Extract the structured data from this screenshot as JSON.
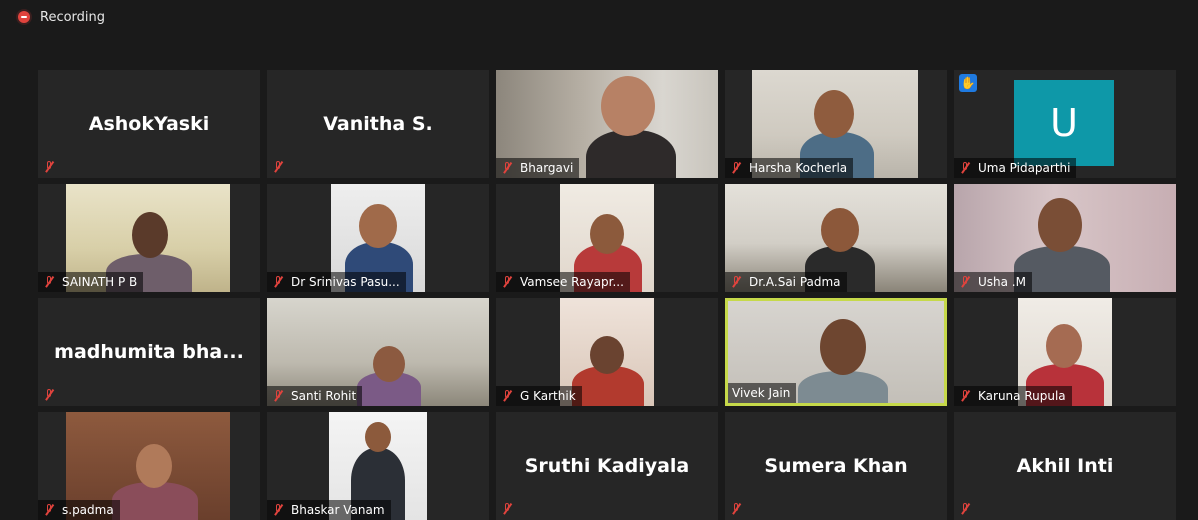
{
  "recording": {
    "label": "Recording",
    "icon": "record-icon"
  },
  "tiles": [
    {
      "name": "AshokYaski",
      "mode": "name"
    },
    {
      "name": "Vanitha S.",
      "mode": "name"
    },
    {
      "name": "Bhargavi",
      "mode": "video",
      "bg": "#b9b1a6"
    },
    {
      "name": "Harsha Kocherla",
      "mode": "video",
      "bg": "#d8d4cc"
    },
    {
      "name": "Uma Pidaparthi",
      "mode": "avatar",
      "avatar_letter": "U",
      "hand_raised": true,
      "hand_icon": "raised-hand-icon"
    },
    {
      "name": "SAINATH P B",
      "mode": "video",
      "bg": "#d9d3b9"
    },
    {
      "name": "Dr Srinivas Pasu...",
      "mode": "video",
      "bg": "#dcdcdc"
    },
    {
      "name": "Vamsee Rayapr...",
      "mode": "video",
      "bg": "#e6e0d8"
    },
    {
      "name": "Dr.A.Sai Padma",
      "mode": "video",
      "bg": "#d7d4cd"
    },
    {
      "name": "Usha .M",
      "mode": "video",
      "bg": "#cbb7b9"
    },
    {
      "name": "madhumita  bha...",
      "mode": "name"
    },
    {
      "name": "Santi Rohit",
      "mode": "video",
      "bg": "#c7c4bb"
    },
    {
      "name": "G Karthik",
      "mode": "video",
      "bg": "#e6d9cf"
    },
    {
      "name": "Vivek Jain",
      "mode": "video",
      "bg": "#c9c6c1",
      "active": true
    },
    {
      "name": "Karuna Rupula",
      "mode": "video",
      "bg": "#e8e3db"
    },
    {
      "name": "s.padma",
      "mode": "video",
      "bg": "#7a4c35"
    },
    {
      "name": "Bhaskar Vanam",
      "mode": "video",
      "bg": "#e8e8e8"
    },
    {
      "name": "Sruthi Kadiyala",
      "mode": "name"
    },
    {
      "name": "Sumera Khan",
      "mode": "name"
    },
    {
      "name": "Akhil Inti",
      "mode": "name"
    }
  ]
}
